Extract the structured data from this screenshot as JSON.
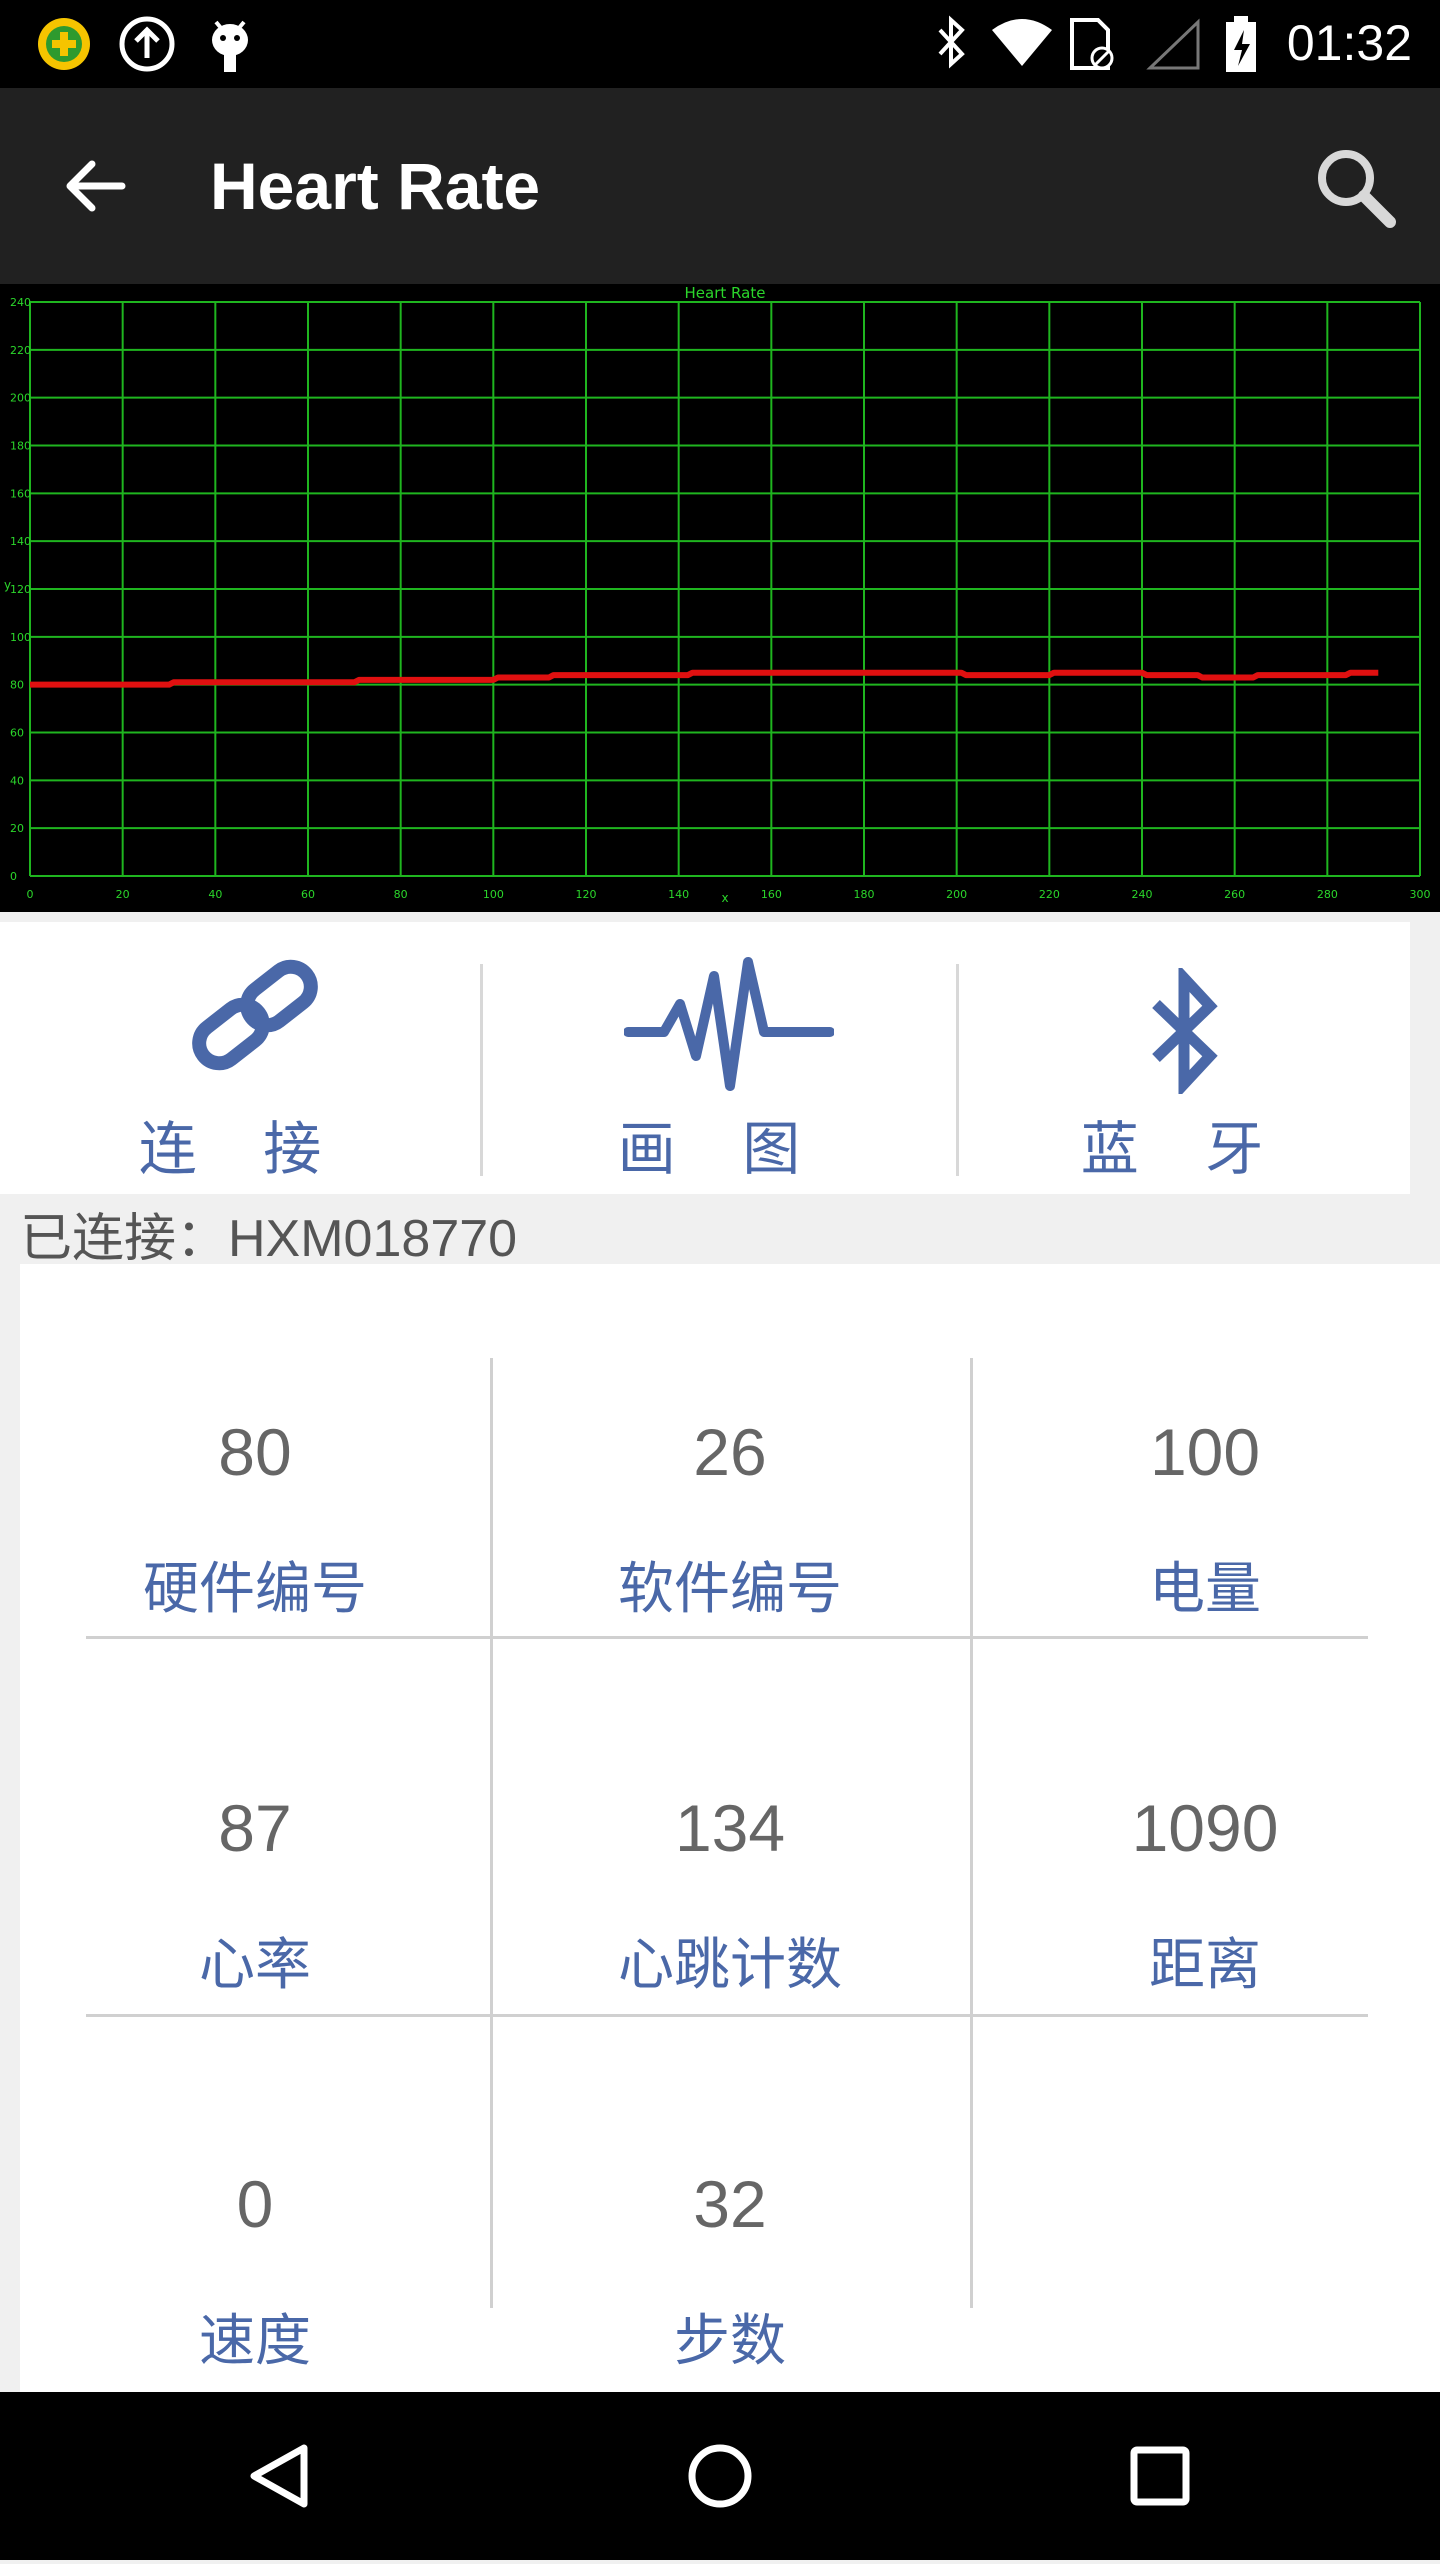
{
  "status_bar": {
    "time": "01:32",
    "icons": [
      "app-plus-icon",
      "upload-icon",
      "android-debug-icon",
      "bluetooth-icon",
      "wifi-icon",
      "sim-icon",
      "signal-icon",
      "battery-charging-icon"
    ]
  },
  "app_bar": {
    "title": "Heart Rate",
    "back_icon": "arrow-left-icon",
    "search_icon": "search-icon"
  },
  "chart_data": {
    "type": "line",
    "title": "Heart Rate",
    "xlabel": "x",
    "ylabel": "y",
    "xlim": [
      0,
      300
    ],
    "ylim": [
      0,
      240
    ],
    "x_ticks": [
      0,
      20,
      40,
      60,
      80,
      100,
      120,
      140,
      160,
      180,
      200,
      220,
      240,
      260,
      280,
      300
    ],
    "y_ticks": [
      0,
      20,
      40,
      60,
      80,
      100,
      120,
      140,
      160,
      180,
      200,
      220,
      240
    ],
    "grid": true,
    "colors": {
      "background": "#000000",
      "grid": "#1fb51f",
      "line": "#e01010",
      "text": "#2bd62b"
    },
    "series": [
      {
        "x": [
          0,
          30,
          31,
          70,
          71,
          100,
          101,
          112,
          113,
          142,
          143,
          201,
          202,
          220,
          221,
          240,
          241,
          252,
          253,
          264,
          265,
          284,
          285,
          291
        ],
        "values": [
          80,
          80,
          81,
          81,
          82,
          82,
          83,
          83,
          84,
          84,
          85,
          85,
          84,
          84,
          85,
          85,
          84,
          84,
          83,
          83,
          84,
          84,
          85,
          85
        ]
      }
    ]
  },
  "toolbar": {
    "connect_label": "连 接",
    "plot_label": "画 图",
    "bluetooth_label": "蓝 牙"
  },
  "connection_status": "已连接：HXM018770",
  "stats": {
    "hardware_id": {
      "value": "80",
      "label": "硬件编号"
    },
    "software_id": {
      "value": "26",
      "label": "软件编号"
    },
    "battery": {
      "value": "100",
      "label": "电量"
    },
    "heart_rate": {
      "value": "87",
      "label": "心率"
    },
    "beat_count": {
      "value": "134",
      "label": "心跳计数"
    },
    "distance": {
      "value": "1090",
      "label": "距离"
    },
    "speed": {
      "value": "0",
      "label": "速度"
    },
    "steps": {
      "value": "32",
      "label": "步数"
    }
  }
}
